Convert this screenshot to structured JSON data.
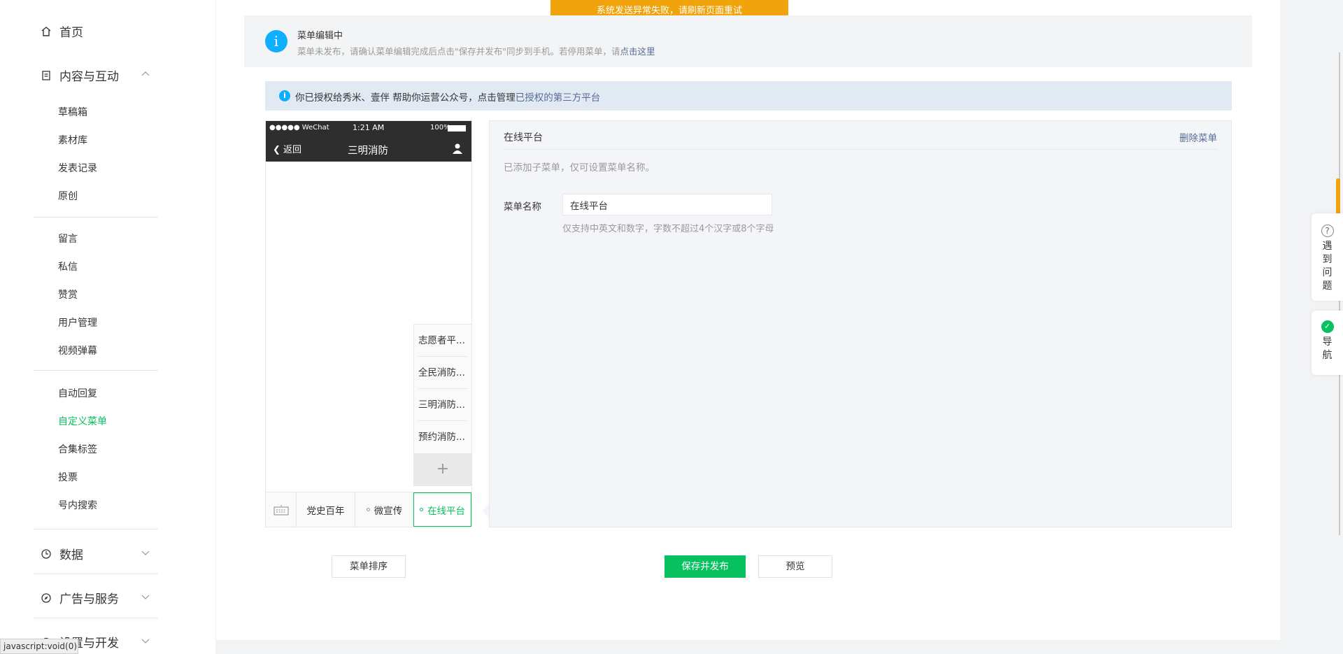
{
  "sidebar": {
    "home": "首页",
    "content_group": "内容与互动",
    "content_items": [
      "草稿箱",
      "素材库",
      "发表记录",
      "原创"
    ],
    "interact_items": [
      "留言",
      "私信",
      "赞赏",
      "用户管理",
      "视频弹幕"
    ],
    "tool_items": [
      "自动回复",
      "自定义菜单",
      "合集标签",
      "投票",
      "号内搜索"
    ],
    "data_group": "数据",
    "ads_group": "广告与服务",
    "dev_group": "设置与开发"
  },
  "toast": "系统发送异常失败，请刷新页面重试",
  "info": {
    "title": "菜单编辑中",
    "desc": "菜单未发布，请确认菜单编辑完成后点击\"保存并发布\"同步到手机。若停用菜单，请",
    "link": "点击这里"
  },
  "notice": {
    "text": "你已授权给秀米、壹伴   帮助你运营公众号，点击管理",
    "link": "已授权的第三方平台"
  },
  "phone": {
    "carrier": "●●●●● WeChat",
    "time": "1:21 AM",
    "battery": "100%",
    "back": "返回",
    "title": "三明消防",
    "bottom_menu": [
      "党史百年",
      "微宣传",
      "在线平台"
    ],
    "submenu": [
      "志愿者平...",
      "全民消防...",
      "三明消防...",
      "预约消防..."
    ],
    "add": "+"
  },
  "editor": {
    "title": "在线平台",
    "delete": "删除菜单",
    "tip": "已添加子菜单，仅可设置菜单名称。",
    "name_label": "菜单名称",
    "name_value": "在线平台",
    "hint": "仅支持中英文和数字，字数不超过4个汉字或8个字母"
  },
  "buttons": {
    "sort": "菜单排序",
    "save": "保存并发布",
    "preview": "预览"
  },
  "float": {
    "help": "遇到问题",
    "nav": "导航"
  },
  "status_url": "javascript:void(0);"
}
